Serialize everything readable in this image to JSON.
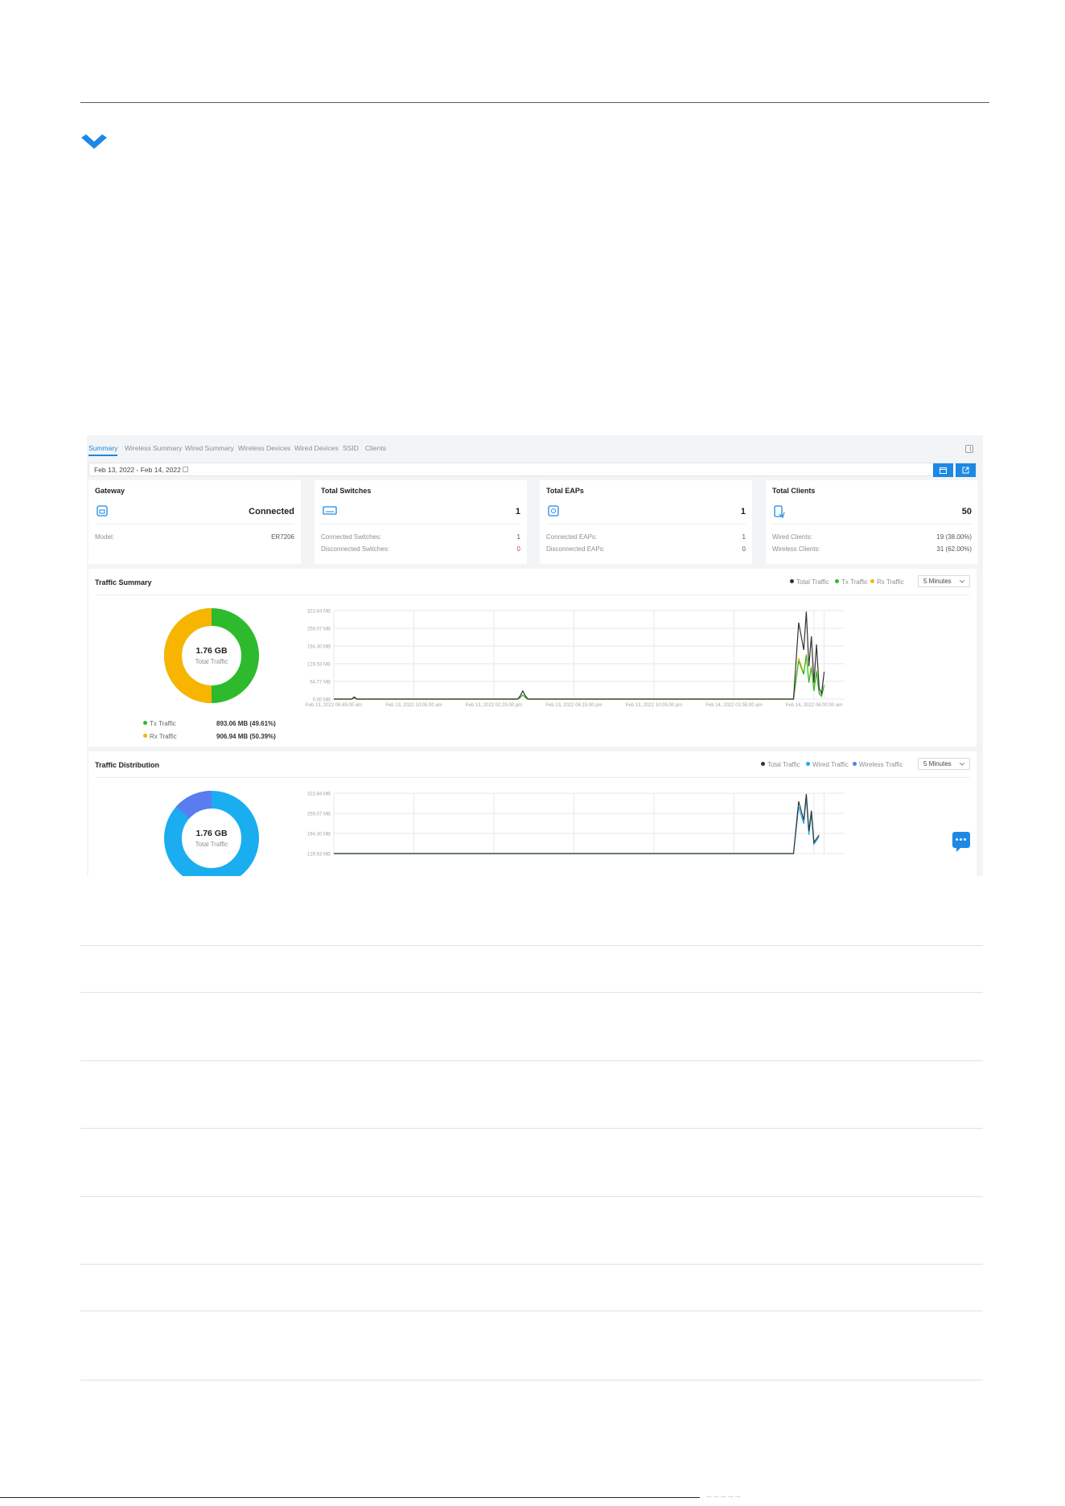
{
  "tabs": [
    {
      "label": "Summary",
      "active": true
    },
    {
      "label": "Wireless Summary"
    },
    {
      "label": "Wired Summary"
    },
    {
      "label": "Wireless Devices"
    },
    {
      "label": "Wired Devices"
    },
    {
      "label": "SSID"
    },
    {
      "label": "Clients"
    }
  ],
  "date_range": {
    "start": "Feb 13, 2022",
    "separator": "-",
    "end": "Feb 14, 2022"
  },
  "cards": {
    "gateway": {
      "title": "Gateway",
      "status": "Connected",
      "model_label": "Model:",
      "model_value": "ER7206"
    },
    "switches": {
      "title": "Total Switches",
      "count": "1",
      "connected_label": "Connected Switches:",
      "connected_value": "1",
      "disconnected_label": "Disconnected Switches:",
      "disconnected_value": "0"
    },
    "eaps": {
      "title": "Total EAPs",
      "count": "1",
      "connected_label": "Connected EAPs:",
      "connected_value": "1",
      "disconnected_label": "Disconnected EAPs:",
      "disconnected_value": "0"
    },
    "clients": {
      "title": "Total Clients",
      "count": "50",
      "wired_label": "Wired Clients:",
      "wired_value": "19 (38.00%)",
      "wireless_label": "Wireless Clients:",
      "wireless_value": "31 (62.00%)"
    }
  },
  "traffic_summary": {
    "title": "Traffic Summary",
    "legend": [
      "Total Traffic",
      "Tx Traffic",
      "Rx Traffic"
    ],
    "interval": "5 Minutes",
    "donut_value": "1.76 GB",
    "donut_label": "Total Traffic",
    "tx_label": "Tx Traffic",
    "tx_value": "893.06 MB (49.61%)",
    "rx_label": "Rx Traffic",
    "rx_value": "906.94 MB (50.39%)"
  },
  "traffic_distribution": {
    "title": "Traffic Distribution",
    "legend": [
      "Total Traffic",
      "Wired Traffic",
      "Wireless Traffic"
    ],
    "interval": "5 Minutes",
    "donut_value": "1.76 GB",
    "donut_label": "Total Traffic"
  },
  "colors": {
    "accent": "#1e88e5",
    "tx": "#2dbb2d",
    "rx": "#f7b500",
    "total": "#333333",
    "wired": "#1aaef0",
    "wireless": "#5a7cf0",
    "danger": "#e53935"
  },
  "icons": [
    "chevron-down-icon",
    "gateway-icon",
    "switch-icon",
    "eap-icon",
    "clients-icon",
    "calendar-icon",
    "export-icon",
    "panel-icon",
    "chat-icon"
  ],
  "chart_data": [
    {
      "type": "pie",
      "categories": [
        "Tx Traffic",
        "Rx Traffic"
      ],
      "values": [
        49.61,
        50.39
      ]
    },
    {
      "type": "line",
      "ylim": [
        0,
        323.84
      ],
      "yticks": [
        "0.00 MB",
        "64.77 MB",
        "129.53 MB",
        "194.30 MB",
        "259.07 MB",
        "323.84 MB"
      ],
      "xticks": [
        "Feb 13, 2022 06:45:00 am",
        "Feb 13, 2022 10:05:00 am",
        "Feb 13, 2022 02:25:00 pm",
        "Feb 13, 2022 06:15:00 pm",
        "Feb 13, 2022 10:05:00 pm",
        "Feb 14, 2022 01:55:00 am",
        "Feb 14, 2022 06:00:00 am"
      ],
      "x": [
        0,
        0.035,
        0.04,
        0.045,
        0.36,
        0.365,
        0.37,
        0.375,
        0.38,
        0.9,
        0.91,
        0.92,
        0.925,
        0.93,
        0.935,
        0.94,
        0.945,
        0.95,
        0.955,
        0.96
      ],
      "series": [
        {
          "name": "Total Traffic",
          "values": [
            0,
            0,
            8,
            0,
            0,
            12,
            30,
            12,
            0,
            0,
            280,
            180,
            320,
            120,
            230,
            60,
            200,
            40,
            20,
            100
          ]
        },
        {
          "name": "Tx Traffic",
          "values": [
            0,
            0,
            4,
            0,
            0,
            6,
            15,
            6,
            0,
            0,
            140,
            90,
            160,
            60,
            115,
            30,
            100,
            20,
            10,
            50
          ]
        },
        {
          "name": "Rx Traffic",
          "values": [
            0,
            0,
            4,
            0,
            0,
            6,
            15,
            6,
            0,
            0,
            150,
            95,
            165,
            65,
            120,
            30,
            105,
            22,
            12,
            52
          ]
        }
      ]
    },
    {
      "type": "pie",
      "categories": [
        "Wired Traffic",
        "Wireless Traffic"
      ],
      "values": [
        88,
        12
      ]
    },
    {
      "type": "line",
      "ylim": [
        0,
        323.84
      ],
      "yticks": [
        "129.53 MB",
        "194.30 MB",
        "259.07 MB",
        "323.84 MB"
      ],
      "x": [
        0,
        0.9,
        0.91,
        0.92,
        0.925,
        0.93,
        0.935,
        0.94,
        0.95
      ],
      "series": [
        {
          "name": "Total Traffic",
          "values": [
            0,
            0,
            280,
            180,
            320,
            120,
            230,
            60,
            100
          ]
        },
        {
          "name": "Wired Traffic",
          "values": [
            0,
            0,
            250,
            160,
            300,
            100,
            210,
            50,
            90
          ]
        }
      ]
    }
  ],
  "footer": {
    "text": "… … … … …"
  }
}
